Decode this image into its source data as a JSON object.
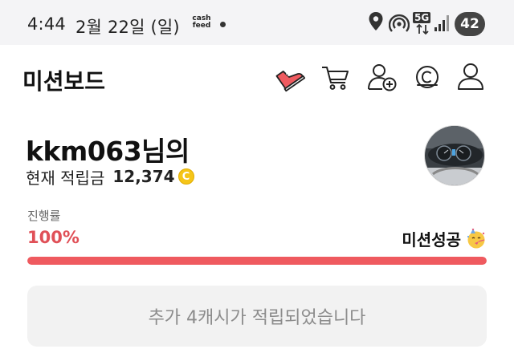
{
  "status_bar": {
    "time": "4:44",
    "date": "2월 22일 (일)",
    "cashfeed_top": "cash",
    "cashfeed_bottom": "feed",
    "network": "5G",
    "battery": "42"
  },
  "header": {
    "title": "미션보드",
    "icons": [
      "sneaker-icon",
      "cart-icon",
      "add-friend-icon",
      "coin-icon",
      "profile-icon"
    ]
  },
  "profile": {
    "name": "kkm063님의",
    "points_label": "현재 적립금",
    "points_value": "12,374",
    "coin_symbol": "C"
  },
  "progress": {
    "label": "진행률",
    "percent": "100%",
    "value": 1.0,
    "status": "미션성공"
  },
  "reward_button": {
    "label": "추가 4캐시가 적립되었습니다"
  },
  "colors": {
    "accent": "#ef5a5f",
    "percent_text": "#e05057",
    "coin": "#f5c518",
    "button_bg": "#f2f2f2",
    "status_bar_bg": "#f4f4f6"
  }
}
